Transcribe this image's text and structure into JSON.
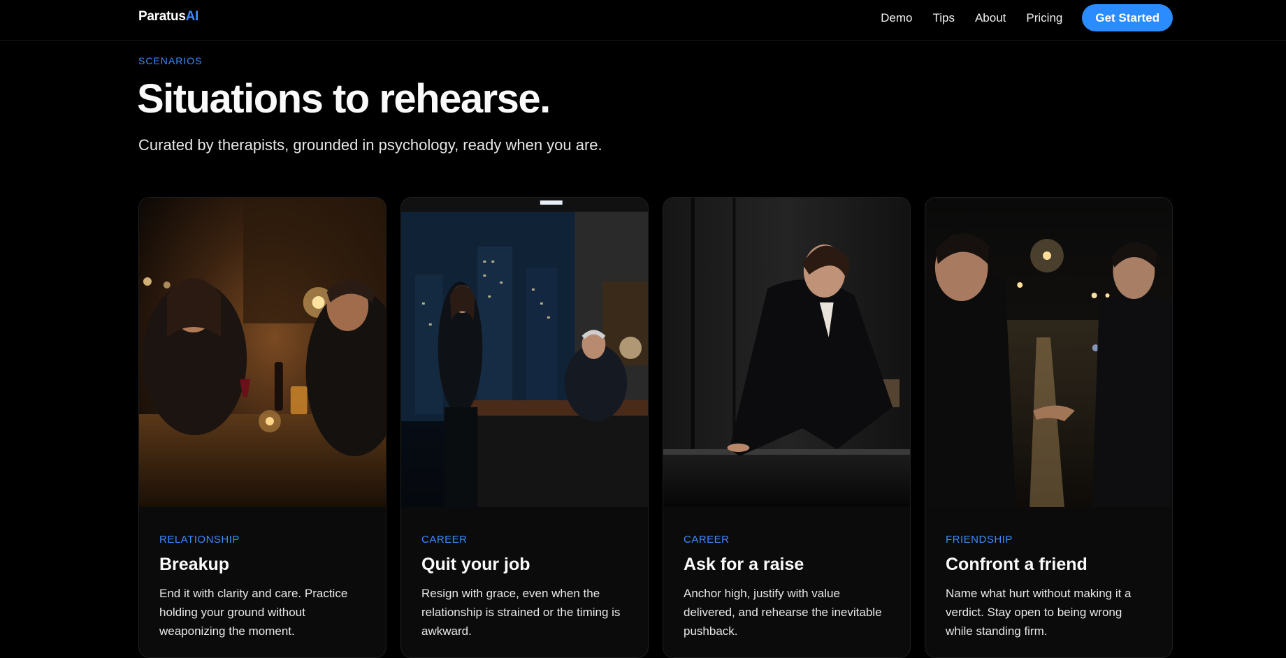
{
  "nav": {
    "logo_main": "Paratus",
    "logo_accent": "AI",
    "links": [
      "Demo",
      "Tips",
      "About",
      "Pricing"
    ],
    "cta": "Get Started"
  },
  "hero": {
    "eyebrow": "SCENARIOS",
    "title": "Situations to rehearse.",
    "subtitle": "Curated by therapists, grounded in psychology, ready when you are."
  },
  "cards": [
    {
      "category": "RELATIONSHIP",
      "title": "Breakup",
      "description": "End it with clarity and care. Practice holding your ground without weaponizing the moment.",
      "image": "couple-at-bar-table-photo"
    },
    {
      "category": "CAREER",
      "title": "Quit your job",
      "description": "Resign with grace, even when the relationship is strained or the timing is awkward.",
      "image": "office-at-night-photo"
    },
    {
      "category": "CAREER",
      "title": "Ask for a raise",
      "description": "Anchor high, justify with value delivered, and rehearse the inevitable pushback.",
      "image": "woman-leaning-on-desk-photo"
    },
    {
      "category": "FRIENDSHIP",
      "title": "Confront a friend",
      "description": "Name what hurt without making it a verdict. Stay open to being wrong while standing firm.",
      "image": "two-men-street-night-photo"
    }
  ],
  "colors": {
    "accent": "#3d8bff",
    "cta_bg": "#2a8cff",
    "background": "#000000",
    "card_bg": "#0b0b0b"
  }
}
